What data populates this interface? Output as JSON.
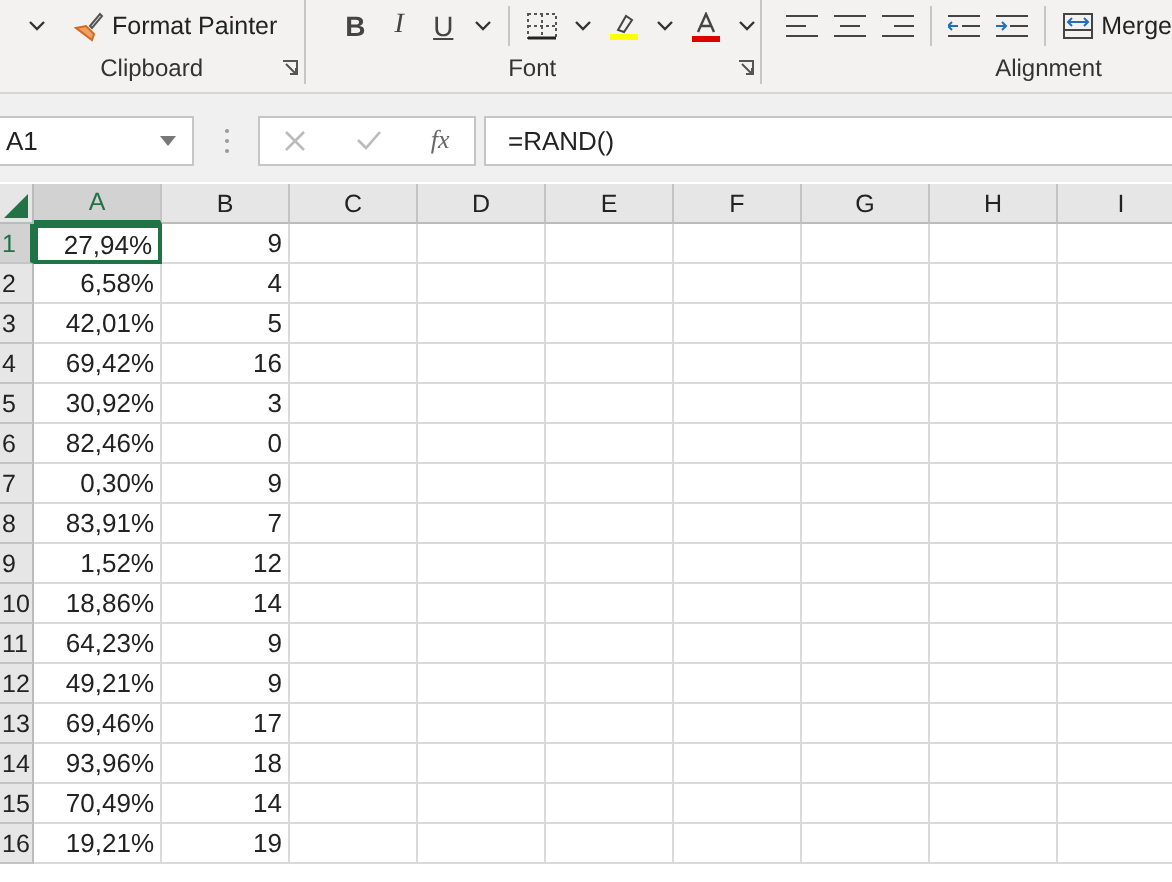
{
  "ribbon": {
    "clipboard": {
      "format_painter": "Format Painter",
      "label": "Clipboard"
    },
    "font": {
      "bold": "B",
      "italic": "I",
      "underline": "U",
      "label": "Font"
    },
    "alignment": {
      "merge": "Merge",
      "label": "Alignment"
    }
  },
  "formula_bar": {
    "name_box": "A1",
    "fx": "fx",
    "formula": "=RAND()"
  },
  "columns": [
    {
      "label": "A",
      "selected": true
    },
    {
      "label": "B",
      "selected": false
    },
    {
      "label": "C",
      "selected": false
    },
    {
      "label": "D",
      "selected": false
    },
    {
      "label": "E",
      "selected": false
    },
    {
      "label": "F",
      "selected": false
    },
    {
      "label": "G",
      "selected": false
    },
    {
      "label": "H",
      "selected": false
    },
    {
      "label": "I",
      "selected": false
    }
  ],
  "rows": [
    {
      "label": "1",
      "selected": true,
      "cells": [
        "27,94%",
        "9"
      ]
    },
    {
      "label": "2",
      "selected": false,
      "cells": [
        "6,58%",
        "4"
      ]
    },
    {
      "label": "3",
      "selected": false,
      "cells": [
        "42,01%",
        "5"
      ]
    },
    {
      "label": "4",
      "selected": false,
      "cells": [
        "69,42%",
        "16"
      ]
    },
    {
      "label": "5",
      "selected": false,
      "cells": [
        "30,92%",
        "3"
      ]
    },
    {
      "label": "6",
      "selected": false,
      "cells": [
        "82,46%",
        "0"
      ]
    },
    {
      "label": "7",
      "selected": false,
      "cells": [
        "0,30%",
        "9"
      ]
    },
    {
      "label": "8",
      "selected": false,
      "cells": [
        "83,91%",
        "7"
      ]
    },
    {
      "label": "9",
      "selected": false,
      "cells": [
        "1,52%",
        "12"
      ]
    },
    {
      "label": "10",
      "selected": false,
      "cells": [
        "18,86%",
        "14"
      ]
    },
    {
      "label": "11",
      "selected": false,
      "cells": [
        "64,23%",
        "9"
      ]
    },
    {
      "label": "12",
      "selected": false,
      "cells": [
        "49,21%",
        "9"
      ]
    },
    {
      "label": "13",
      "selected": false,
      "cells": [
        "69,46%",
        "17"
      ]
    },
    {
      "label": "14",
      "selected": false,
      "cells": [
        "93,96%",
        "18"
      ]
    },
    {
      "label": "15",
      "selected": false,
      "cells": [
        "70,49%",
        "14"
      ]
    },
    {
      "label": "16",
      "selected": false,
      "cells": [
        "19,21%",
        "19"
      ]
    }
  ]
}
